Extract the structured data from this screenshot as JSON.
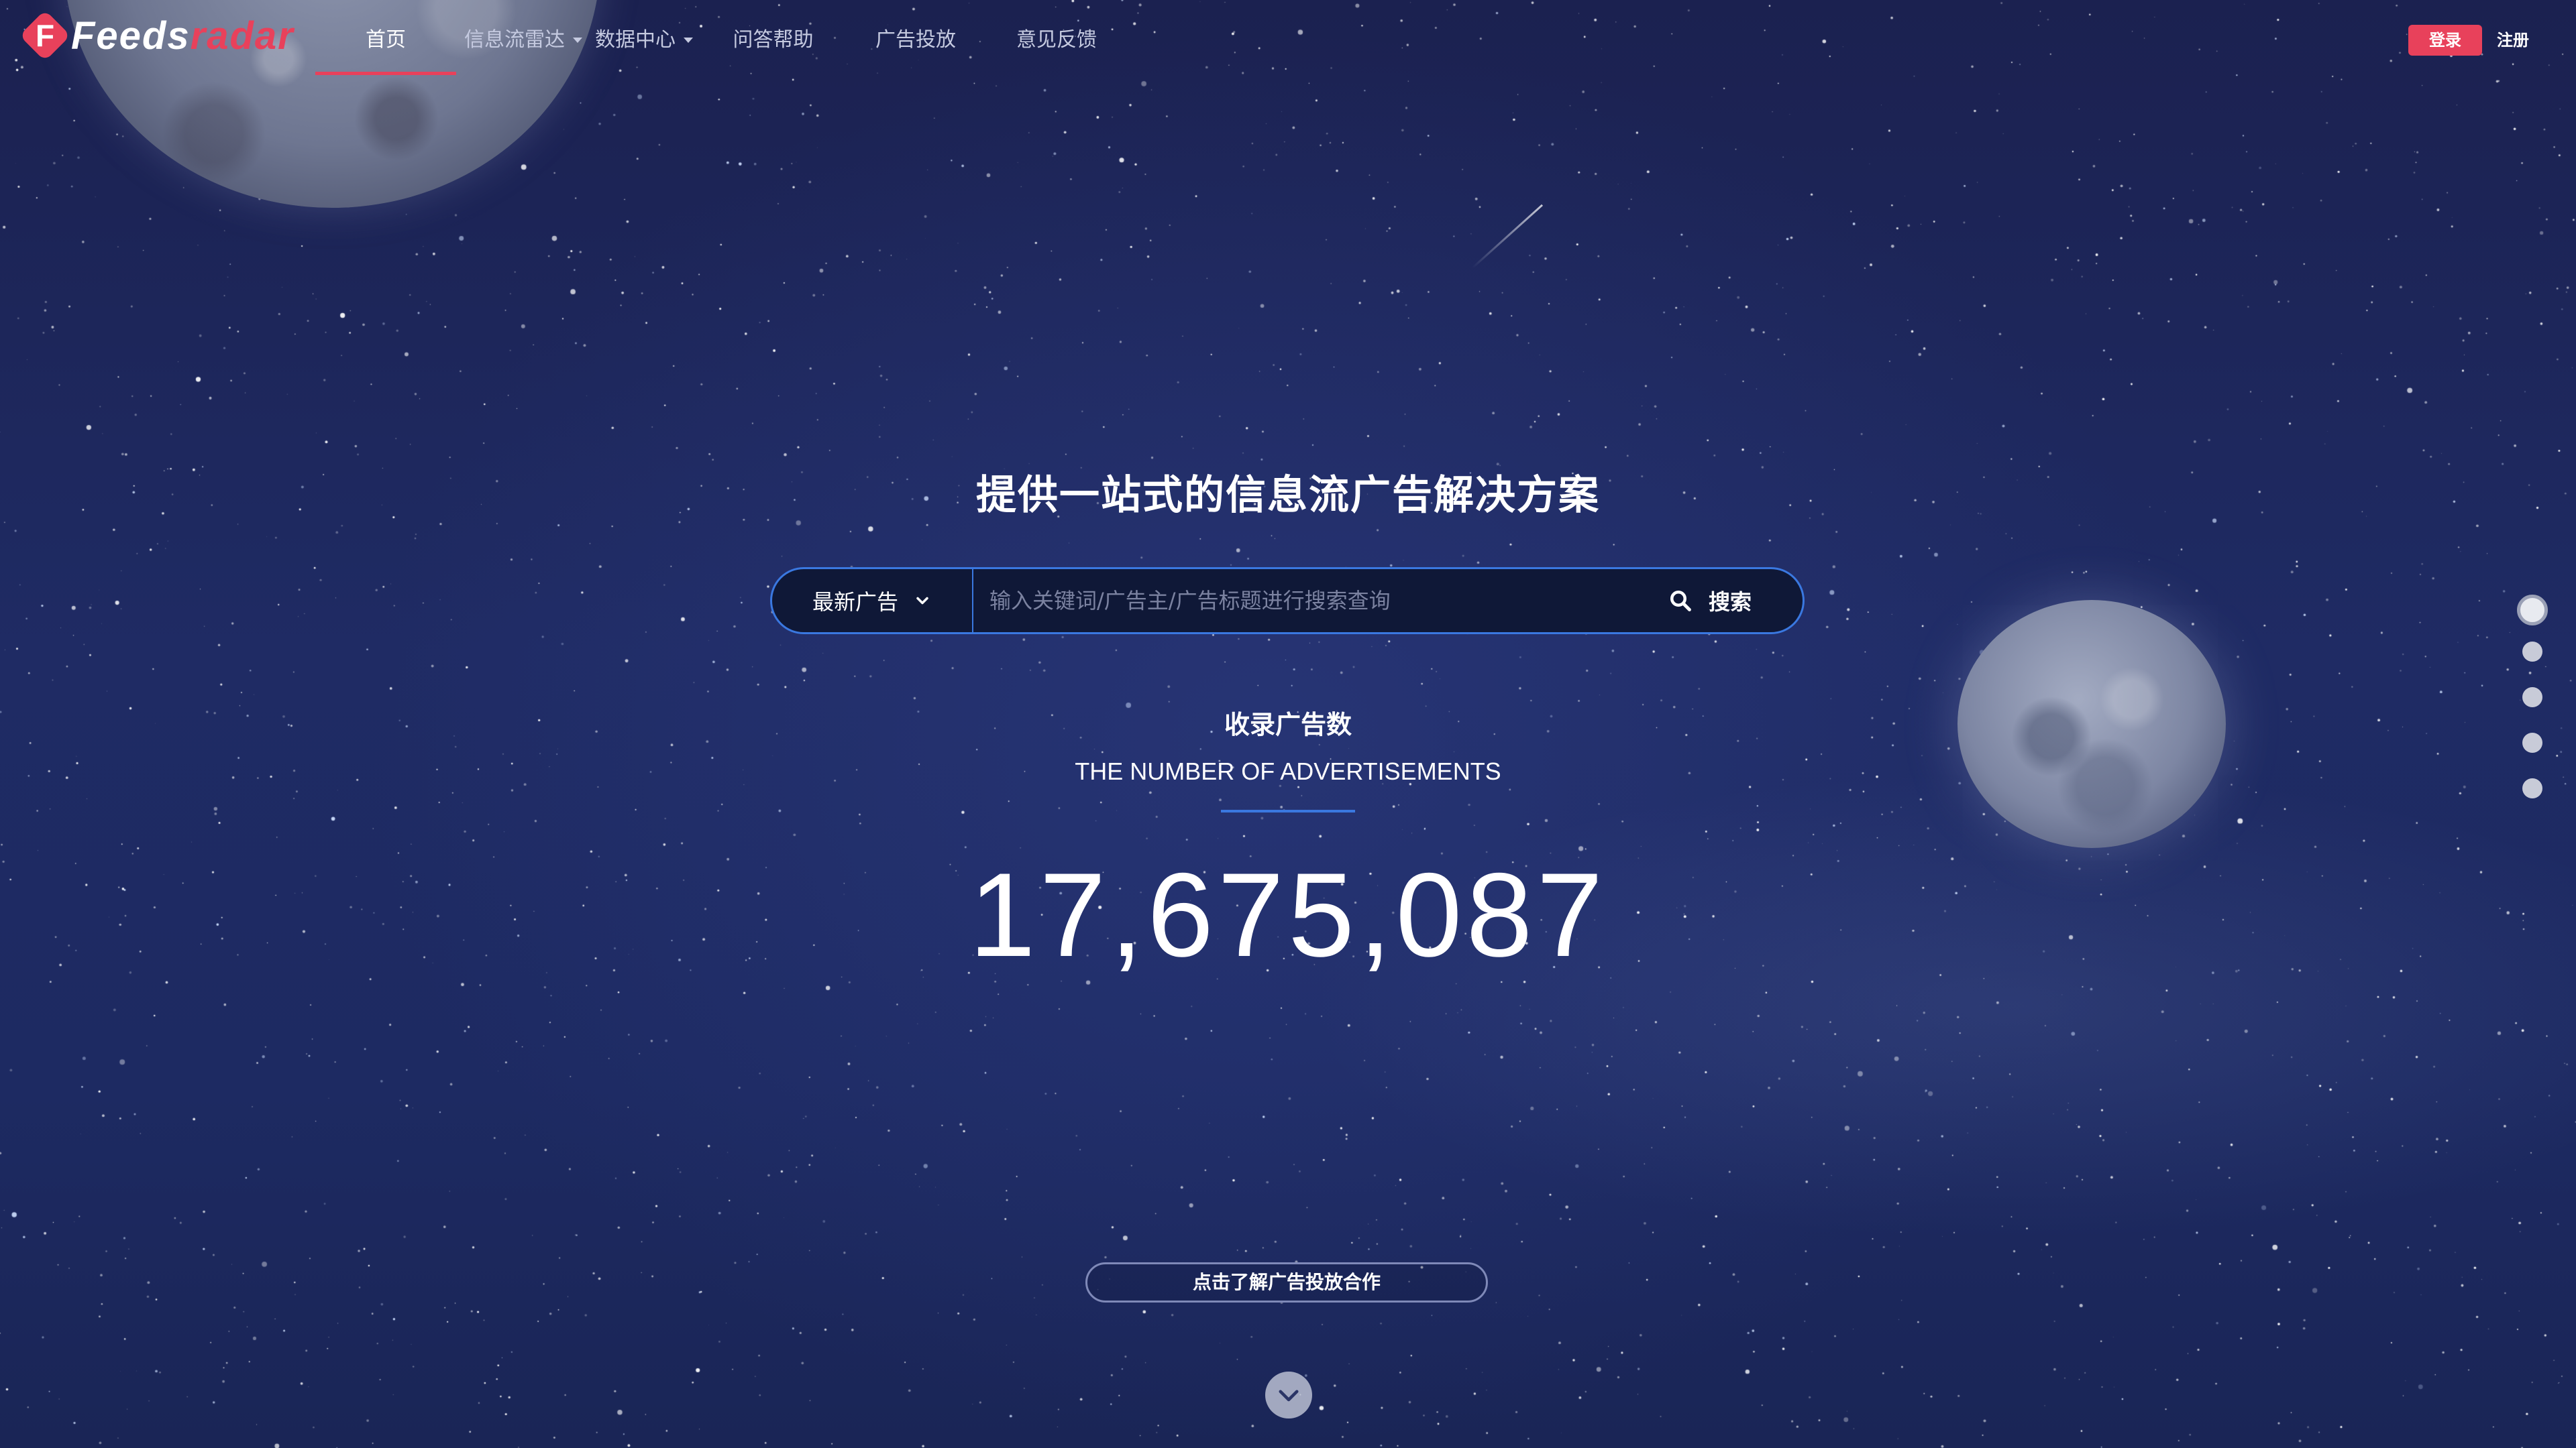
{
  "brand": {
    "logo_letter": "F",
    "name_part1": "Feeds",
    "name_part2": "radar",
    "accent_color": "#e8415b"
  },
  "nav": {
    "items": [
      {
        "label": "首页",
        "active": true,
        "dropdown": false
      },
      {
        "label": "信息流雷达",
        "active": false,
        "dropdown": true
      },
      {
        "label": "数据中心",
        "active": false,
        "dropdown": true
      },
      {
        "label": "问答帮助",
        "active": false,
        "dropdown": false
      },
      {
        "label": "广告投放",
        "active": false,
        "dropdown": false
      },
      {
        "label": "意见反馈",
        "active": false,
        "dropdown": false
      }
    ],
    "login_label": "登录",
    "register_label": "注册"
  },
  "hero": {
    "headline": "提供一站式的信息流广告解决方案",
    "search": {
      "category": "最新广告",
      "placeholder": "输入关键词/广告主/广告标题进行搜索查询",
      "value": "",
      "button_label": "搜索"
    },
    "count_title_cn": "收录广告数",
    "count_title_en": "THE NUMBER OF ADVERTISEMENTS",
    "count_value": "17,675,087",
    "cta_label": "点击了解广告投放合作"
  },
  "pagination": {
    "total": 5,
    "active_index": 0
  },
  "colors": {
    "background": "#1f2b64",
    "search_border": "#3a78e0",
    "nav_text": "#c5cae0"
  },
  "icons": {
    "search": "search-icon",
    "dropdown": "chevron-down-icon",
    "scroll": "chevron-down-icon"
  }
}
